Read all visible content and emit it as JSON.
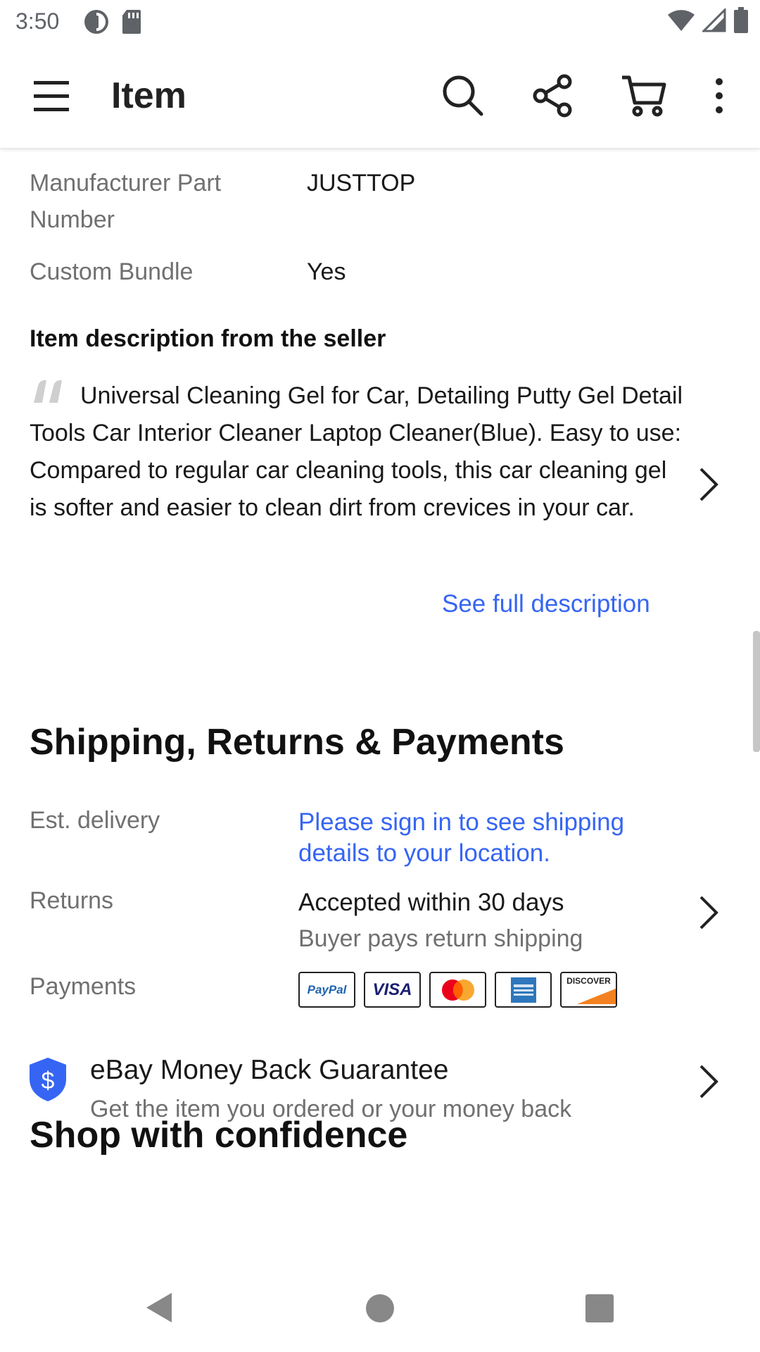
{
  "status_bar": {
    "time": "3:50",
    "left_icons": [
      "data-saver-icon",
      "sd-card-icon"
    ],
    "right_icons": [
      "wifi-icon",
      "signal-icon",
      "battery-icon"
    ]
  },
  "app_bar": {
    "title": "Item",
    "icons": [
      "menu-icon",
      "search-icon",
      "share-icon",
      "cart-icon",
      "more-vert-icon"
    ]
  },
  "specs": [
    {
      "label": "Manufacturer Part Number",
      "value": "JUSTTOP"
    },
    {
      "label": "Custom Bundle",
      "value": "Yes"
    }
  ],
  "description": {
    "heading": "Item description from the seller",
    "text": "Universal Cleaning Gel for Car, Detailing Putty Gel Detail Tools Car Interior Cleaner Laptop Cleaner(Blue). Easy to use: Compared to regular car cleaning tools, this car cleaning gel is softer and easier to clean dirt from crevices in your car.",
    "see_full": "See full description"
  },
  "shipping": {
    "heading": "Shipping, Returns & Payments",
    "delivery_label": "Est. delivery",
    "delivery_value": "Please sign in to see shipping details to your location.",
    "returns_label": "Returns",
    "returns_main": "Accepted within 30 days",
    "returns_sub": "Buyer pays return shipping",
    "payments_label": "Payments",
    "payment_logos": {
      "paypal": "PayPal",
      "visa": "VISA",
      "mastercard": "mastercard-logo",
      "amex": "amex-logo",
      "discover": "DISCOVER"
    }
  },
  "confidence": {
    "heading": "Shop with confidence",
    "item_title": "eBay Money Back Guarantee",
    "item_sub": "Get the item you ordered or your money back"
  },
  "colors": {
    "link": "#3665f3",
    "text": "#191919",
    "muted": "#707070",
    "shield": "#3665f3"
  },
  "nav_bar": {
    "icons": [
      "back-icon",
      "home-icon",
      "recents-icon"
    ]
  }
}
